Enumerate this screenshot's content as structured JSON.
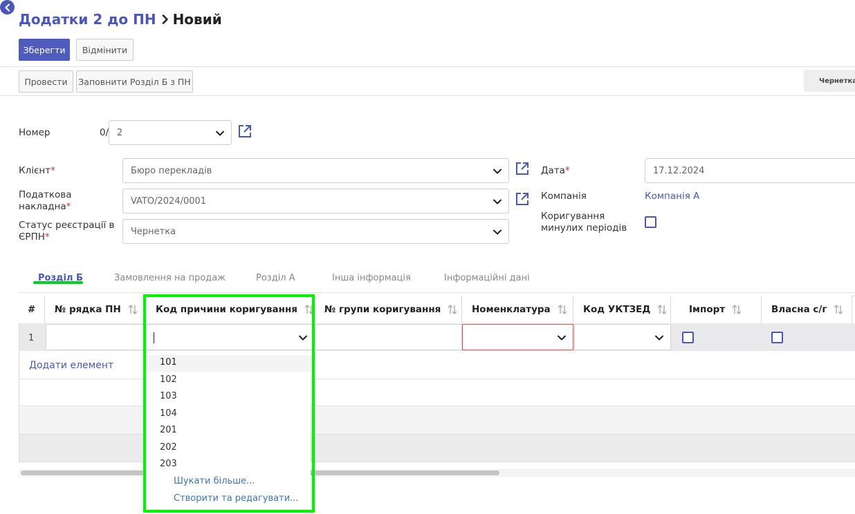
{
  "breadcrumb": {
    "parent": "Додатки 2 до ПН",
    "current": "Новий"
  },
  "toolbar": {
    "save": "Зберегти",
    "discard": "Відмінити"
  },
  "actions": {
    "post": "Провести",
    "fill": "Заповнити Розділ Б з ПН"
  },
  "status": "Чернетка",
  "form": {
    "number": {
      "label": "Номер",
      "prefix": "0/",
      "value": "2"
    },
    "client": {
      "label": "Клієнт",
      "value": "Бюро перекладів"
    },
    "tax_invoice": {
      "label_l1": "Податкова",
      "label_l2": "накладна",
      "value": "VATO/2024/0001"
    },
    "reg_status": {
      "label_l1": "Статус реєстрації в",
      "label_l2": "ЄРПН",
      "value": "Чернетка"
    },
    "date": {
      "label": "Дата",
      "value": "17.12.2024"
    },
    "company": {
      "label": "Компанія",
      "value": "Компанія А"
    },
    "correction": {
      "label_l1": "Коригування",
      "label_l2": "минулих періодів"
    }
  },
  "tabs": [
    "Розділ Б",
    "Замовлення на продаж",
    "Розділ А",
    "Інша інформація",
    "Інформаційні дані"
  ],
  "table": {
    "columns": [
      "#",
      "№ рядка ПН",
      "Код причини коригування",
      "№ групи коригування",
      "Номенклатура",
      "Код УКТЗЕД",
      "Імпорт",
      "Власна с/г"
    ],
    "row_num": "1",
    "add_item": "Додати елемент"
  },
  "dropdown": {
    "options": [
      "101",
      "102",
      "103",
      "104",
      "201",
      "202",
      "203"
    ],
    "search_more": "Шукати більше...",
    "create_edit": "Створити та редагувати..."
  },
  "colors": {
    "accent": "#4a57b7",
    "highlight": "#00f500",
    "underline": "#00d21e"
  }
}
